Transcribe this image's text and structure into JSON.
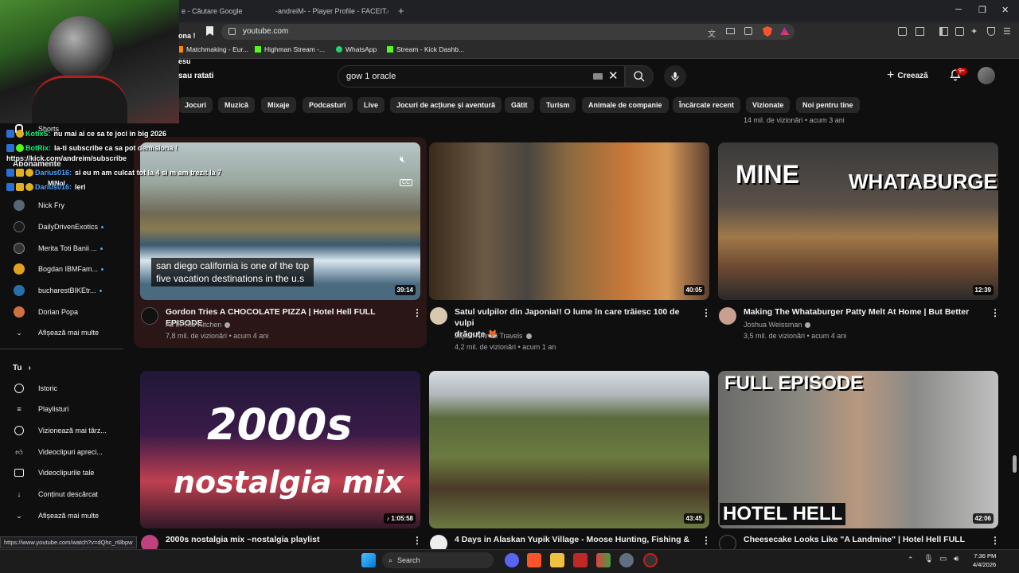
{
  "browser": {
    "tabs": [
      {
        "label": "e - Căutare Google"
      },
      {
        "label": "-andreiM- - Player Profile - FACEIT.co"
      }
    ],
    "new_tab": "+",
    "url": "youtube.com",
    "bookmarks": [
      {
        "label": "Matchmaking - Eur...",
        "color": "#ff8a00"
      },
      {
        "label": "Highman Stream -...",
        "color": "#53fc18"
      },
      {
        "label": "WhatsApp",
        "color": "#25d366"
      },
      {
        "label": "Stream - Kick Dashb...",
        "color": "#53fc18"
      }
    ],
    "window_controls": {
      "minimize": "─",
      "restore": "❐",
      "close": "✕"
    }
  },
  "masthead": {
    "search_value": "gow 1 oracle",
    "create_label": "Creează",
    "notif_count": "9+"
  },
  "chips": [
    "Jocuri",
    "Muzică",
    "Mixaje",
    "Podcasturi",
    "Live",
    "Jocuri de acțiune și aventură",
    "Gătit",
    "Turism",
    "Animale de companie",
    "Încărcate recent",
    "Vizionate",
    "Noi pentru tine"
  ],
  "sidebar": {
    "shorts": "Shorts",
    "subscriptions_heading": "Abonamente",
    "channels": [
      {
        "label": "Nick Fry",
        "color": "#556677",
        "dot": false
      },
      {
        "label": "DailyDrivenExotics",
        "color": "#1a1a1a",
        "dot": true
      },
      {
        "label": "Merita Toti Banii ...",
        "color": "#333333",
        "dot": true
      },
      {
        "label": "Bogdan IBMFam...",
        "color": "#e0a020",
        "dot": true
      },
      {
        "label": "bucharestBIKEtr...",
        "color": "#2a6fa8",
        "dot": true
      },
      {
        "label": "Dorian Popa",
        "color": "#d07040",
        "dot": false
      }
    ],
    "show_more_1": "Afișează mai multe",
    "you_heading": "Tu",
    "you_items": [
      {
        "label": "Istoric",
        "icon": "history-icon"
      },
      {
        "label": "Playlisturi",
        "icon": "playlist-icon"
      },
      {
        "label": "Vizionează mai târz...",
        "icon": "watch-later-icon"
      },
      {
        "label": "Videoclipuri apreci...",
        "icon": "thumbs-up-icon"
      },
      {
        "label": "Videoclipurile tale",
        "icon": "your-videos-icon"
      },
      {
        "label": "Conținut descărcat",
        "icon": "download-icon"
      }
    ],
    "show_more_2": "Afișează mai multe"
  },
  "top_row_meta_fragment": "14 mil. de vizionări • acum 3 ani",
  "videos": [
    {
      "title": "Gordon Tries A CHOCOLATE PIZZA | Hotel Hell FULL EPISODE",
      "title2": "",
      "channel": "All In The Kitchen",
      "meta": "7,8 mil. de vizionări • acum 4 ani",
      "duration": "39:14",
      "caption1": "san diego california is one of the top",
      "caption2": "five vacation destinations in the u.s",
      "cc": "CC"
    },
    {
      "title": "Satul vulpilor din Japonia!! O lume în care trăiesc 100 de vulpi",
      "title2": "drăguțe 🦊",
      "channel": "Japan Animal Travels",
      "meta": "4,2 mil. de vizionări • acum 1 an",
      "duration": "40:05"
    },
    {
      "title": "Making The Whataburger Patty Melt At Home | But Better",
      "title2": "",
      "channel": "Joshua Weissman",
      "meta": "3,5 mil. de vizionări • acum 4 ani",
      "duration": "12:39",
      "thumb_text1": "MINE",
      "thumb_text2": "WHATABURGER"
    },
    {
      "title": "2000s nostalgia mix ~nostalgia playlist",
      "duration": "♪ 1:05:58",
      "thumb_text1": "2000s",
      "thumb_text2": "nostalgia mix"
    },
    {
      "title": "4 Days in Alaskan Yupik Village - Moose Hunting, Fishing &",
      "duration": "43:45"
    },
    {
      "title": "Cheesecake Looks Like \"A Landmine\" | Hotel Hell FULL",
      "duration": "42:06",
      "thumb_text1": "FULL EPISODE",
      "thumb_text2": "HOTEL HELL"
    }
  ],
  "chat": [
    {
      "user": "KotixS:",
      "msg": "nu mai ai ce sa te joci in big 2026",
      "color": "#00ff7f"
    },
    {
      "user": "BotRix:",
      "msg": "la-ti subscribe ca sa pot demisiona !",
      "color": "#00ff7f"
    },
    {
      "user": "",
      "msg": "https://kick.com/andreim/subscribe",
      "color": "#ffffff"
    },
    {
      "user": "Darius016:",
      "msg": "si eu m am culcat tot la 4 si m am trezit la 7",
      "color": "#4da6ff"
    },
    {
      "user": "",
      "msg": "MiNol",
      "color": "#ffffff"
    },
    {
      "user": "Darius016:",
      "msg": "leri",
      "color": "#4da6ff"
    }
  ],
  "overlay_partial": {
    "line1": "ona !",
    "line2": "esu",
    "line3": "sau ratati"
  },
  "status_url": "https://www.youtube.com/watch?v=dQhc_r6lbpw",
  "taskbar": {
    "search": "Search",
    "time": "7:36 PM",
    "date": "4/4/2026"
  }
}
